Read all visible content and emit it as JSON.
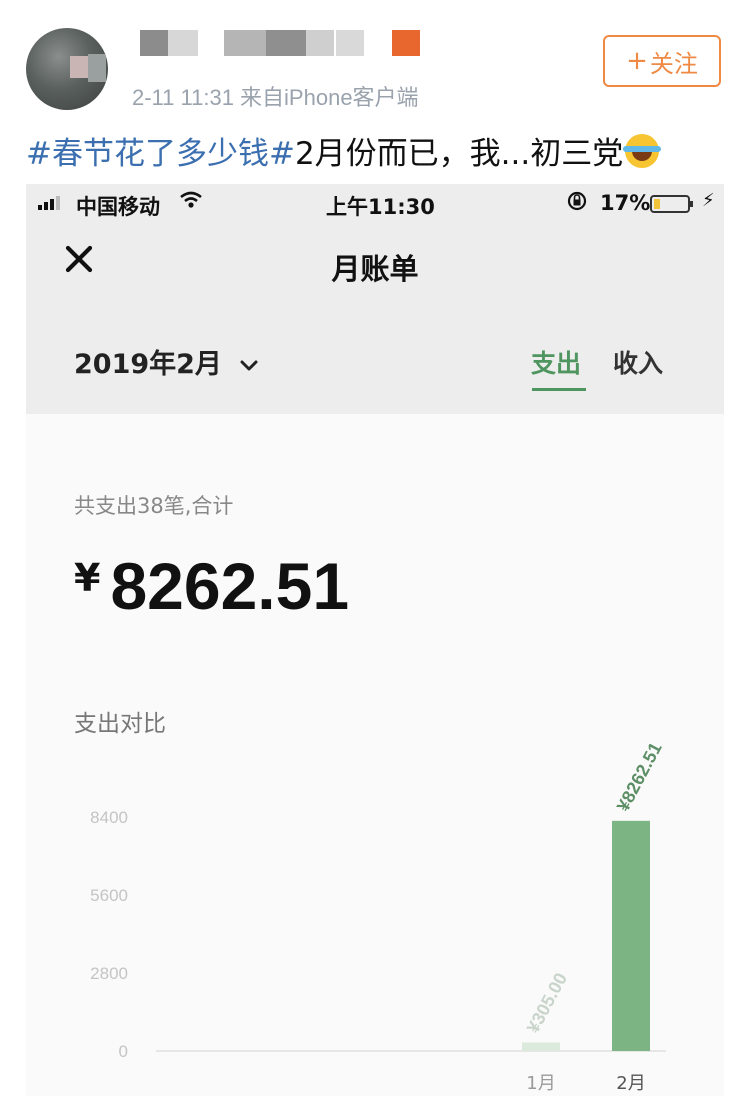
{
  "post": {
    "meta": "2-11 11:31 来自iPhone客户端",
    "follow_label": "关注",
    "follow_plus": "+",
    "text_topic": "#春节花了多少钱#",
    "text_body": "2月份而已，我...初三党"
  },
  "phone": {
    "status": {
      "carrier": "中国移动",
      "time": "上午11:30",
      "battery": "17%",
      "battery_color": "#f2c43a"
    },
    "nav": {
      "close_icon": "×",
      "title": "月账单"
    },
    "filter": {
      "month": "2019年2月",
      "chevron": "⌄",
      "tab_expense": "支出",
      "tab_income": "收入",
      "active_color": "#4f9560"
    },
    "summary": {
      "label": "共支出38笔,合计",
      "currency": "¥",
      "amount": "8262.51"
    },
    "compare_label": "支出对比"
  },
  "chart_data": {
    "type": "bar",
    "categories": [
      "1月",
      "2月"
    ],
    "values": [
      305.0,
      8262.51
    ],
    "value_labels": [
      "¥305.00",
      "¥8262.51"
    ],
    "ylim": [
      0,
      8400
    ],
    "yticks": [
      "8400",
      "5600",
      "2800",
      "0"
    ],
    "bar_colors": [
      "#dbeadc",
      "#7cb583"
    ],
    "value_label_colors": [
      "#c9d4cb",
      "#5d8f67"
    ],
    "category_colors": [
      "#9a9a9a",
      "#555555"
    ]
  }
}
